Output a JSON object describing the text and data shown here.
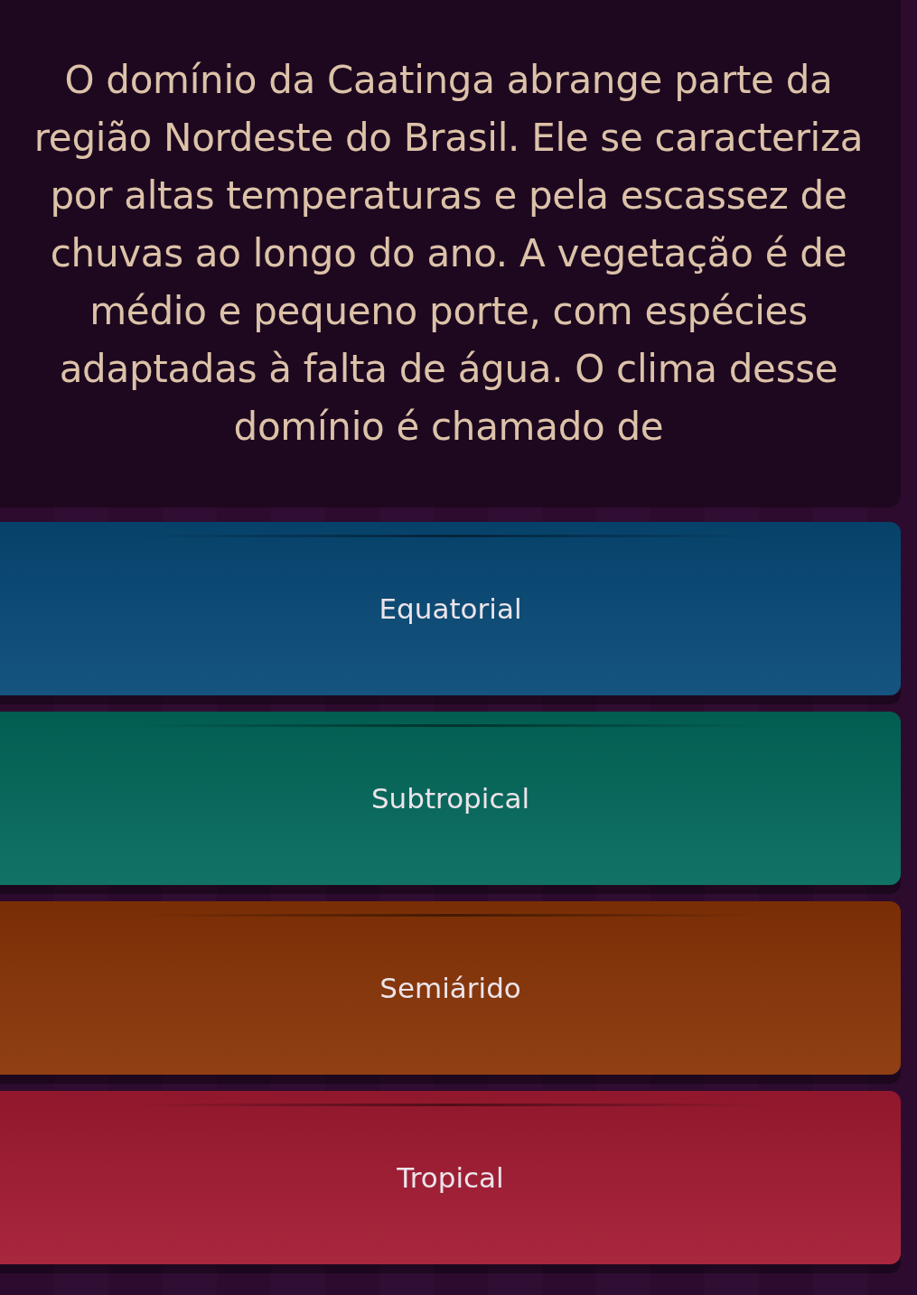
{
  "question": "O domínio da Caatinga abrange parte da região Nordeste do Brasil. Ele se caracteriza por altas temperaturas e pela escassez de chuvas ao longo do ano. A vegetação é de médio e pequeno porte, com espécies adaptadas à falta de água. O clima desse domínio é chamado de",
  "answers": [
    {
      "label": "Equatorial",
      "color": "#074a78"
    },
    {
      "label": "Subtropical",
      "color": "#026a5c"
    },
    {
      "label": "Semiárido",
      "color": "#8a3406"
    },
    {
      "label": "Tropical",
      "color": "#a41a32"
    }
  ]
}
